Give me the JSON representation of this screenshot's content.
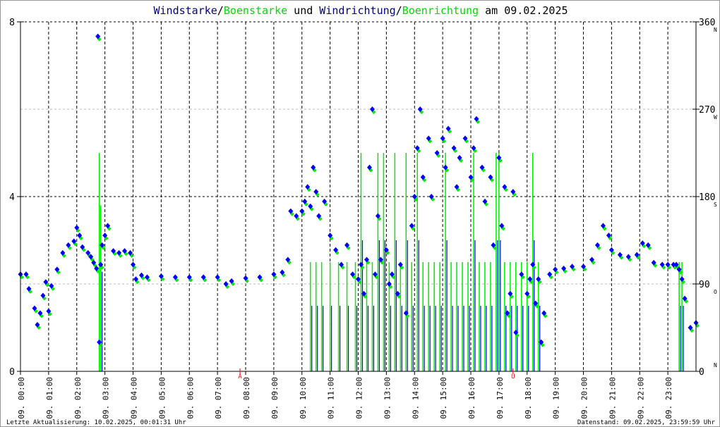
{
  "chart_data": {
    "type": "scatter",
    "title_parts": [
      {
        "text": "Windstarke",
        "color": "#000080"
      },
      {
        "text": "/",
        "color": "#000000"
      },
      {
        "text": "Boenstarke",
        "color": "#00dd00"
      },
      {
        "text": " und ",
        "color": "#000000"
      },
      {
        "text": "Windrichtung",
        "color": "#000080"
      },
      {
        "text": "/",
        "color": "#000000"
      },
      {
        "text": "Boenrichtung",
        "color": "#00dd00"
      },
      {
        "text": " am 09.02.2025",
        "color": "#000000"
      }
    ],
    "xlim_hours": [
      0,
      24
    ],
    "x_ticks": [
      "09. 00:00",
      "09. 01:00",
      "09. 02:00",
      "09. 03:00",
      "09. 04:00",
      "09. 05:00",
      "09. 06:00",
      "09. 07:00",
      "09. 08:00",
      "09. 09:00",
      "09. 10:00",
      "09. 11:00",
      "09. 12:00",
      "09. 13:00",
      "09. 14:00",
      "09. 15:00",
      "09. 16:00",
      "09. 17:00",
      "09. 18:00",
      "09. 19:00",
      "09. 20:00",
      "09. 21:00",
      "09. 22:00",
      "09. 23:00"
    ],
    "y_left": {
      "label": "Windstarke",
      "ylim": [
        0,
        8
      ],
      "ticks": [
        "0",
        "4",
        "8"
      ]
    },
    "y_right": {
      "label": "Windrichtung",
      "ylim": [
        0,
        360
      ],
      "ticks": [
        "0",
        "90",
        "180",
        "270",
        "360"
      ],
      "compass": [
        "N",
        "O",
        "S",
        "W",
        "N"
      ]
    },
    "sun_markers": [
      {
        "label": "A",
        "hour": 7.8
      },
      {
        "label": "U",
        "hour": 17.5
      }
    ],
    "colors": {
      "wind": "#0000ff",
      "gust": "#00ee00",
      "sun": "#ff0000"
    },
    "direction_series": {
      "name": "Windrichtung",
      "hours": [
        0.0,
        0.2,
        0.3,
        0.5,
        0.6,
        0.7,
        0.8,
        0.9,
        1.0,
        1.1,
        1.3,
        1.5,
        1.7,
        1.9,
        2.0,
        2.1,
        2.2,
        2.4,
        2.5,
        2.6,
        2.7,
        2.75,
        2.8,
        2.85,
        2.9,
        3.0,
        3.1,
        3.3,
        3.5,
        3.7,
        3.9,
        4.0,
        4.1,
        4.3,
        4.5,
        5.0,
        5.5,
        6.0,
        6.5,
        7.0,
        7.3,
        7.5,
        8.0,
        8.5,
        9.0,
        9.3,
        9.5,
        9.6,
        9.8,
        10.0,
        10.1,
        10.2,
        10.3,
        10.4,
        10.5,
        10.6,
        10.8,
        11.0,
        11.2,
        11.4,
        11.6,
        11.8,
        12.0,
        12.1,
        12.2,
        12.3,
        12.4,
        12.5,
        12.6,
        12.7,
        12.8,
        13.0,
        13.1,
        13.2,
        13.4,
        13.5,
        13.7,
        13.9,
        14.0,
        14.1,
        14.2,
        14.3,
        14.5,
        14.6,
        14.8,
        15.0,
        15.1,
        15.2,
        15.4,
        15.5,
        15.6,
        15.8,
        16.0,
        16.1,
        16.2,
        16.4,
        16.5,
        16.7,
        16.8,
        17.0,
        17.1,
        17.2,
        17.3,
        17.4,
        17.5,
        17.6,
        17.8,
        18.0,
        18.1,
        18.2,
        18.3,
        18.4,
        18.5,
        18.6,
        18.8,
        19.0,
        19.3,
        19.6,
        20.0,
        20.3,
        20.5,
        20.7,
        20.9,
        21.0,
        21.3,
        21.6,
        21.9,
        22.1,
        22.3,
        22.5,
        22.8,
        23.0,
        23.2,
        23.3,
        23.4,
        23.5,
        23.6,
        23.8,
        24.0
      ],
      "degrees": [
        100,
        100,
        85,
        65,
        48,
        60,
        78,
        92,
        62,
        88,
        105,
        122,
        130,
        134,
        148,
        140,
        128,
        122,
        118,
        112,
        106,
        345,
        30,
        110,
        130,
        140,
        150,
        124,
        122,
        124,
        122,
        110,
        95,
        99,
        97,
        98,
        97,
        97,
        97,
        97,
        90,
        93,
        96,
        97,
        100,
        102,
        115,
        165,
        160,
        165,
        175,
        190,
        170,
        210,
        185,
        160,
        175,
        140,
        125,
        110,
        130,
        100,
        95,
        110,
        80,
        115,
        210,
        270,
        100,
        160,
        115,
        125,
        90,
        100,
        80,
        110,
        60,
        150,
        180,
        230,
        270,
        200,
        240,
        180,
        225,
        240,
        210,
        250,
        230,
        190,
        220,
        240,
        200,
        230,
        260,
        210,
        175,
        200,
        130,
        220,
        150,
        190,
        60,
        80,
        185,
        40,
        100,
        80,
        95,
        110,
        70,
        95,
        30,
        60,
        100,
        105,
        106,
        108,
        108,
        115,
        130,
        150,
        140,
        125,
        120,
        118,
        120,
        132,
        130,
        112,
        110,
        110,
        110,
        110,
        105,
        95,
        75,
        45,
        50,
        48,
        48
      ]
    },
    "gust_series": {
      "name": "Boenstarke",
      "hours": [
        2.8,
        2.85,
        10.3,
        10.5,
        10.7,
        11.0,
        11.3,
        11.6,
        11.9,
        12.1,
        12.3,
        12.5,
        12.7,
        12.9,
        13.1,
        13.3,
        13.5,
        13.7,
        13.9,
        14.1,
        14.3,
        14.5,
        14.7,
        14.9,
        15.1,
        15.3,
        15.5,
        15.7,
        15.9,
        16.1,
        16.3,
        16.5,
        16.7,
        16.9,
        17.0,
        17.2,
        17.4,
        17.6,
        17.8,
        18.0,
        18.2,
        18.4,
        23.4,
        23.5
      ],
      "values": [
        5,
        3.8,
        2.5,
        2.5,
        2.5,
        2.5,
        2.5,
        2.5,
        2.5,
        5,
        2.5,
        2.5,
        5,
        5,
        2.5,
        5,
        2.5,
        5,
        2.5,
        5,
        2.5,
        2.5,
        2.5,
        2.5,
        5,
        2.5,
        2.5,
        2.5,
        2.5,
        5,
        2.5,
        2.5,
        2.5,
        5,
        5,
        2.5,
        2.5,
        2.5,
        2.5,
        2.5,
        5,
        2.5,
        2.5,
        2.5
      ]
    }
  },
  "footer": {
    "left": "Letzte Aktualisierung: 10.02.2025, 00:01:31 Uhr",
    "right": "Datenstand: 09.02.2025, 23:59:59 Uhr"
  }
}
